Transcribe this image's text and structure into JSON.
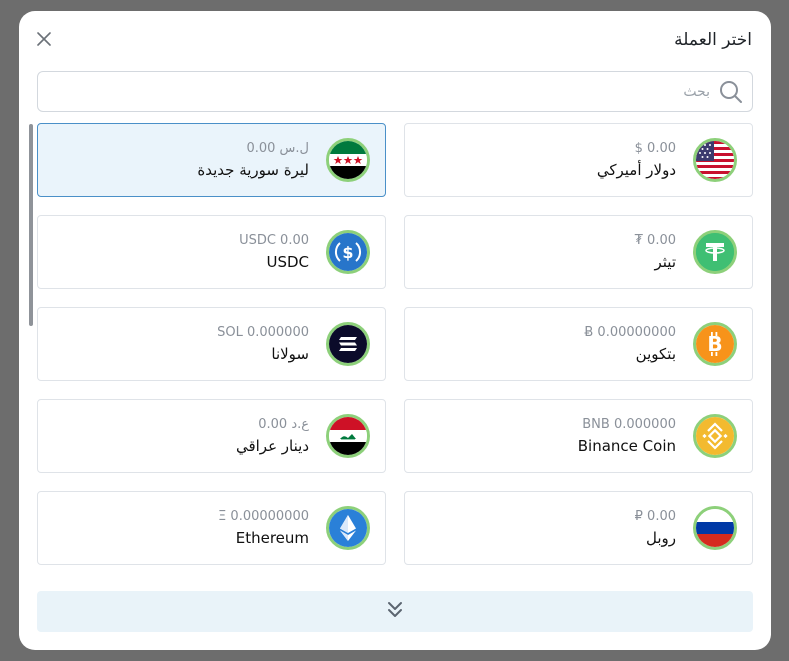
{
  "modal": {
    "title": "اختر العملة",
    "search_placeholder": "بحث"
  },
  "currencies": [
    {
      "name": "دولار أميركي",
      "amount": "$ 0.00",
      "icon": "usd-flag-icon",
      "selected": false
    },
    {
      "name": "ليرة سورية جديدة",
      "amount": "0.00 ل.س",
      "icon": "syria-flag-icon",
      "selected": true
    },
    {
      "name": "تيثر",
      "amount": "₮ 0.00",
      "icon": "tether-icon",
      "selected": false
    },
    {
      "name": "USDC",
      "amount": "USDC 0.00",
      "icon": "usdc-icon",
      "selected": false
    },
    {
      "name": "بتكوين",
      "amount": "Ƀ 0.00000000",
      "icon": "bitcoin-icon",
      "selected": false
    },
    {
      "name": "سولانا",
      "amount": "SOL 0.000000",
      "icon": "solana-icon",
      "selected": false
    },
    {
      "name": "Binance Coin",
      "amount": "BNB 0.000000",
      "icon": "bnb-icon",
      "selected": false
    },
    {
      "name": "دينار عراقي",
      "amount": "0.00 ع.د",
      "icon": "iraq-flag-icon",
      "selected": false
    },
    {
      "name": "روبل",
      "amount": "₽ 0.00",
      "icon": "russia-flag-icon",
      "selected": false
    },
    {
      "name": "Ethereum",
      "amount": "Ξ 0.00000000",
      "icon": "ethereum-icon",
      "selected": false
    }
  ],
  "colors": {
    "selected_bg": "#eaf4fb",
    "selected_border": "#4a90c8",
    "coin_ring": "#8dd07a",
    "more_button_bg": "#e9f3f9"
  },
  "icons": {
    "close": "close-icon",
    "search": "search-icon",
    "more": "chevron-double-down-icon"
  }
}
